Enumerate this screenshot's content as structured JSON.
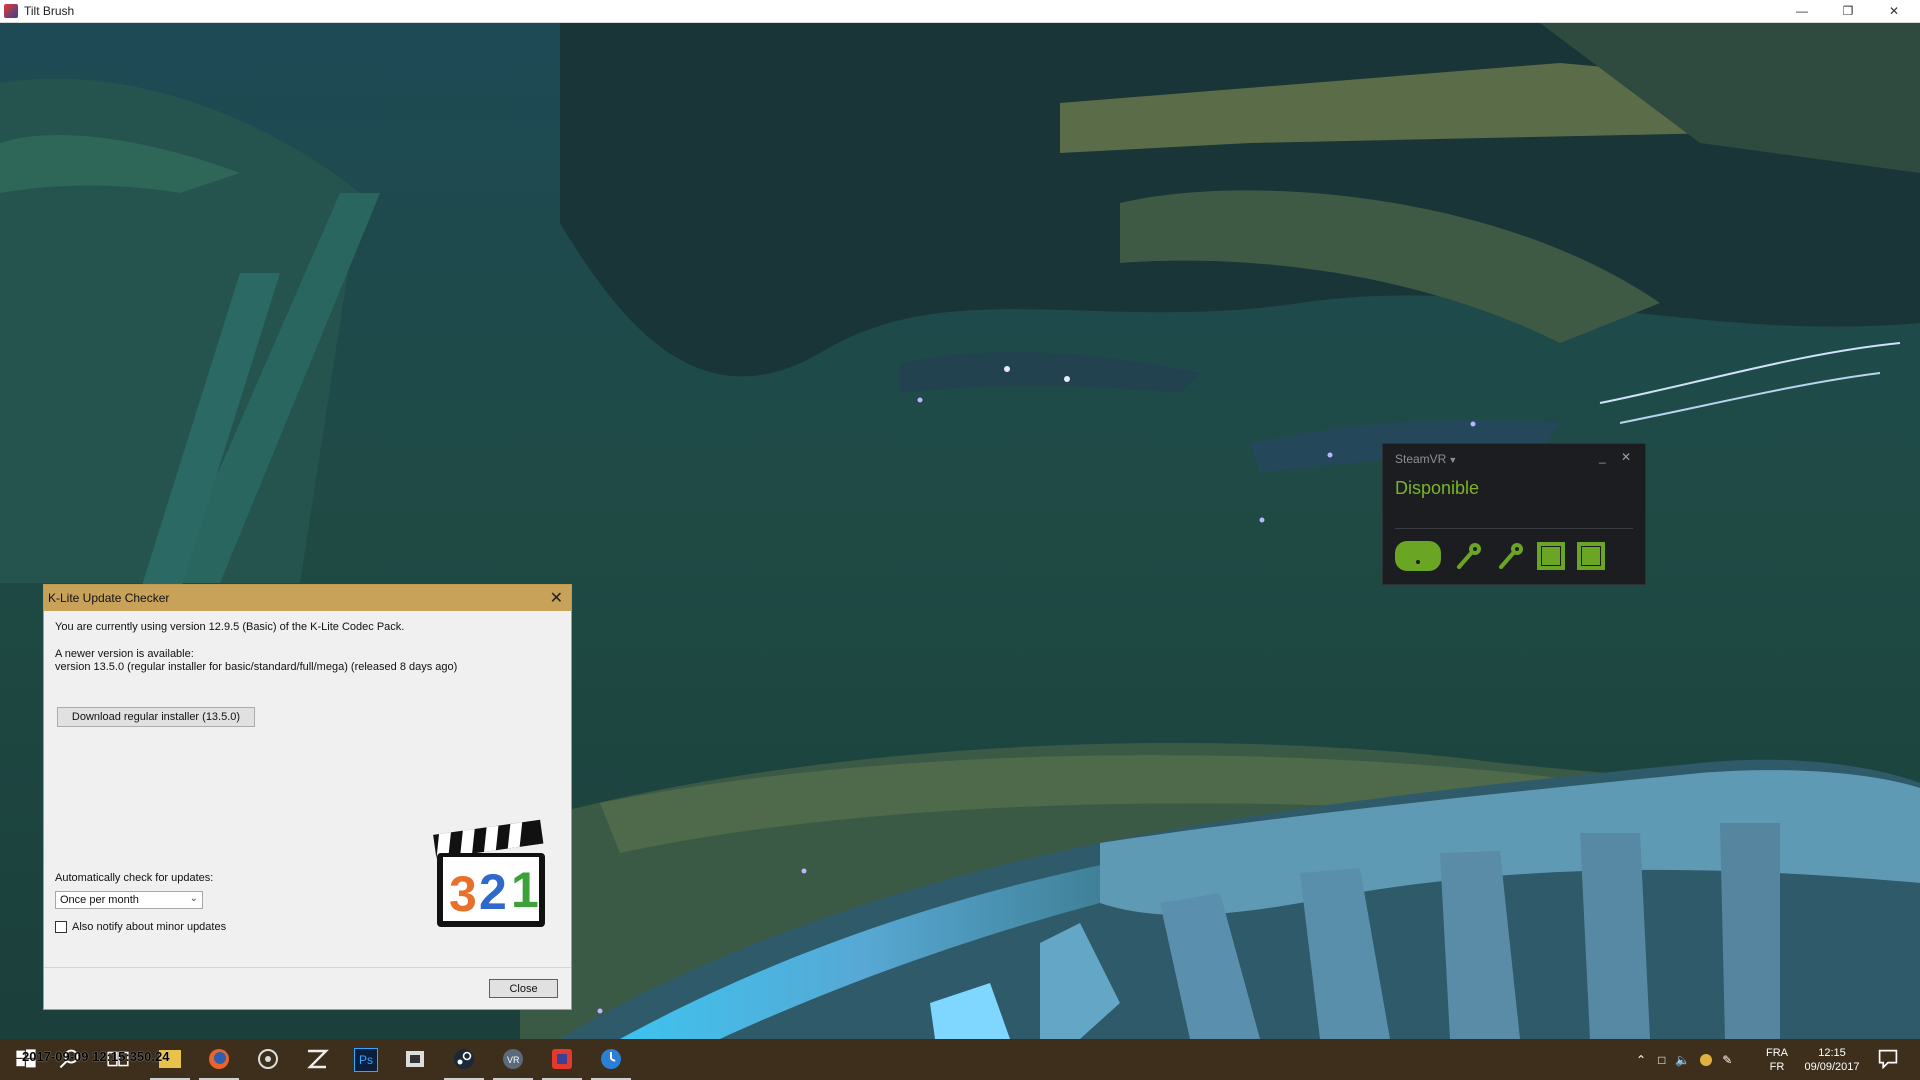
{
  "window": {
    "title": "Tilt Brush"
  },
  "steamvr": {
    "menu_label": "SteamVR",
    "status": "Disponible",
    "minimize": "_",
    "close": "✕"
  },
  "klite": {
    "title": "K-Lite Update Checker",
    "line_current": "You are currently using version 12.9.5 (Basic) of the K-Lite Codec Pack.",
    "line_newer": "A newer version is available:",
    "line_version": "version 13.5.0  (regular installer for basic/standard/full/mega)  (released 8 days ago)",
    "download_button": "Download regular installer (13.5.0)",
    "auto_check_label": "Automatically check for updates:",
    "frequency_selected": "Once per month",
    "minor_updates_label": "Also notify about minor updates",
    "minor_updates_checked": false,
    "close_button": "Close",
    "logo_digits": [
      "3",
      "2",
      "1"
    ]
  },
  "taskbar": {
    "overlay_stamp": "2017-09-09 12:15:350.24",
    "tray": {
      "language_code": "FRA",
      "language_region": "FR",
      "time": "12:15",
      "date": "09/09/2017"
    },
    "icons": [
      "windows-icon",
      "search-icon",
      "task-view-icon",
      "explorer-icon",
      "firefox-icon",
      "media-icon",
      "zbrush-icon",
      "photoshop-icon",
      "film-icon",
      "steam-icon",
      "vr-icon",
      "tiltbrush-icon",
      "clock-app-icon"
    ]
  },
  "colors": {
    "steamvr_green": "#7ab527",
    "dialog_title": "#c9a25a",
    "taskbar": "#3e2f1c"
  }
}
